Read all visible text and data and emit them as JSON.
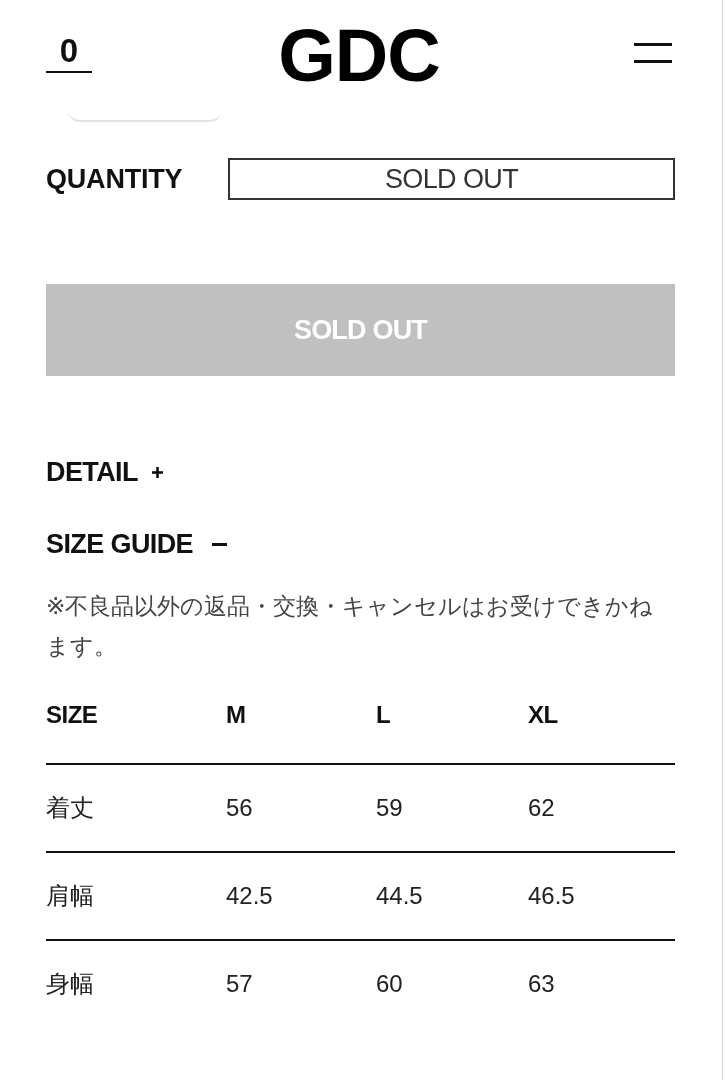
{
  "header": {
    "cart_count": "0",
    "logo": "GDC"
  },
  "quantity": {
    "label": "QUANTITY",
    "value": "SOLD OUT"
  },
  "buy_button": {
    "label": "SOLD OUT",
    "disabled": true
  },
  "sections": [
    {
      "title": "DETAIL",
      "expanded": false
    },
    {
      "title": "SIZE GUIDE",
      "expanded": true
    }
  ],
  "size_guide": {
    "note": "※不良品以外の返品・交換・キャンセルはお受けできかねます。",
    "columns": [
      "SIZE",
      "M",
      "L",
      "XL"
    ],
    "rows": [
      [
        "着丈",
        "56",
        "59",
        "62"
      ],
      [
        "肩幅",
        "42.5",
        "44.5",
        "46.5"
      ],
      [
        "身幅",
        "57",
        "60",
        "63"
      ]
    ]
  }
}
